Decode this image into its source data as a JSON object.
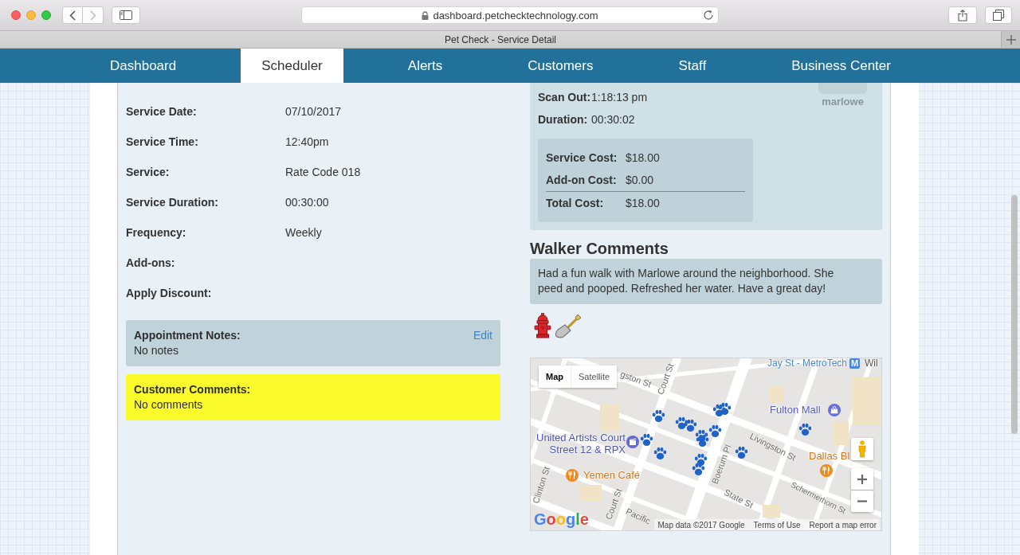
{
  "browser": {
    "nav_buttons": [
      {
        "kind": "back",
        "disabled": false
      },
      {
        "kind": "forward",
        "disabled": true
      }
    ],
    "url": "dashboard.petchecktechnology.com",
    "tab_title": "Pet Check - Service Detail"
  },
  "nav": [
    {
      "label": "Dashboard",
      "selected": false
    },
    {
      "label": "Scheduler",
      "selected": true
    },
    {
      "label": "Alerts",
      "selected": false
    },
    {
      "label": "Customers",
      "selected": false
    },
    {
      "label": "Staff",
      "selected": false
    },
    {
      "label": "Business Center",
      "selected": false
    }
  ],
  "service_details": [
    {
      "label": "Service Date:",
      "value": "07/10/2017"
    },
    {
      "label": "Service Time:",
      "value": "12:40pm"
    },
    {
      "label": "Service:",
      "value": "Rate Code 018"
    },
    {
      "label": "Service Duration:",
      "value": "00:30:00"
    },
    {
      "label": "Frequency:",
      "value": "Weekly"
    },
    {
      "label": "Add-ons:"
    },
    {
      "label": "Apply Discount:"
    }
  ],
  "appointment_notes": {
    "title": "Appointment Notes:",
    "text": "No notes",
    "action": "Edit"
  },
  "customer_comments": {
    "title": "Customer Comments:",
    "text": "No comments"
  },
  "visit": {
    "times": [
      {
        "label": "Scan Out:",
        "value": "1:18:13 pm"
      },
      {
        "label": "Duration:",
        "value": "00:30:02"
      }
    ],
    "pet_name": "marlowe",
    "costs": [
      {
        "kind": "item",
        "label": "Service Cost:",
        "value": "$18.00"
      },
      {
        "kind": "item",
        "label": "Add-on Cost:",
        "value": "$0.00"
      },
      {
        "kind": "total",
        "label": "Total Cost:",
        "value": "$18.00"
      }
    ]
  },
  "walker_comments": {
    "heading": "Walker Comments",
    "text": "Had a fun walk with Marlowe around the neighborhood. She peed and pooped. Refreshed her water. Have a great day!",
    "activities": [
      {
        "kind": "pee"
      },
      {
        "kind": "poop"
      }
    ]
  },
  "map": {
    "map_types": [
      {
        "label": "Map",
        "selected": true
      },
      {
        "label": "Satellite",
        "selected": false
      }
    ],
    "labels": [
      {
        "text": "Jay St - MetroTech",
        "kind": "transit",
        "badge": "M"
      },
      {
        "text": "Wil",
        "kind": "place"
      },
      {
        "text": "Fulton Mall",
        "kind": "shopping"
      },
      {
        "text": "United Artists Court Street 12 & RPX",
        "kind": "cinema"
      },
      {
        "text": "Yemen Café",
        "kind": "food"
      },
      {
        "text": "Dallas Bl",
        "kind": "food"
      },
      {
        "text": "gston St",
        "kind": "street"
      },
      {
        "text": "Court St",
        "kind": "street"
      },
      {
        "text": "Livingston St",
        "kind": "street"
      },
      {
        "text": "Boerum Pl",
        "kind": "street"
      },
      {
        "text": "State St",
        "kind": "street"
      },
      {
        "text": "Schermerhorn St",
        "kind": "street"
      },
      {
        "text": "Clinton St",
        "kind": "street"
      },
      {
        "text": "Court St",
        "kind": "street"
      },
      {
        "text": "Pacific",
        "kind": "street"
      }
    ],
    "logo": "Google",
    "attribution": [
      "Map data ©2017 Google",
      "Terms of Use",
      "Report a map error"
    ]
  }
}
